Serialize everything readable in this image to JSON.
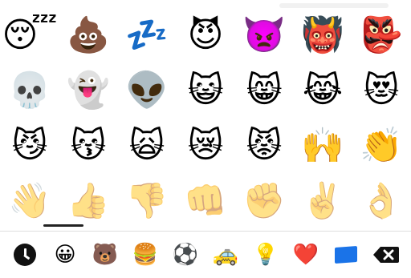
{
  "emoji_rows": [
    [
      "😴",
      "💩",
      "💤",
      "😈",
      "👿",
      "👹",
      "👺"
    ],
    [
      "💀",
      "👻",
      "👽",
      "😺",
      "😸",
      "😹",
      "😻"
    ],
    [
      "😼",
      "😽",
      "🙀",
      "😿",
      "😾",
      "🙌",
      "👏"
    ],
    [
      "👋",
      "👍",
      "👎",
      "👊",
      "✊",
      "✌️",
      "👌"
    ]
  ],
  "categories": {
    "recent": "clock-icon",
    "smileys": "😀",
    "animals": "🐻",
    "food": "🍔",
    "activity": "⚽",
    "travel": "🚕",
    "objects": "💡",
    "symbols": "❤️",
    "flags": "flag-icon"
  },
  "colors": {
    "indicator": "#222222",
    "flag": "#1a73e8",
    "delete": "#111111"
  }
}
